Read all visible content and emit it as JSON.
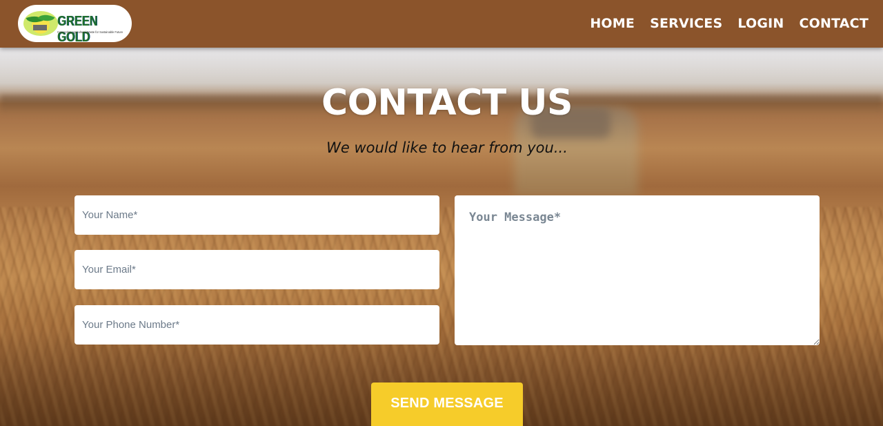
{
  "brand": {
    "name": "GREEN GOLD",
    "tagline": "Connecting Agricultural Waste for Sustainable Future"
  },
  "nav": {
    "items": [
      {
        "label": "HOME"
      },
      {
        "label": "SERVICES"
      },
      {
        "label": "LOGIN"
      },
      {
        "label": "CONTACT"
      }
    ]
  },
  "hero": {
    "title": "CONTACT US",
    "subtitle": "We would like to hear from you..."
  },
  "form": {
    "name_placeholder": "Your Name*",
    "email_placeholder": "Your Email*",
    "phone_placeholder": "Your Phone Number*",
    "message_placeholder": "Your Message*",
    "submit_label": "SEND MESSAGE"
  },
  "colors": {
    "navbar": "#8b542b",
    "button": "#f6cc2a",
    "title": "#ffffff"
  }
}
